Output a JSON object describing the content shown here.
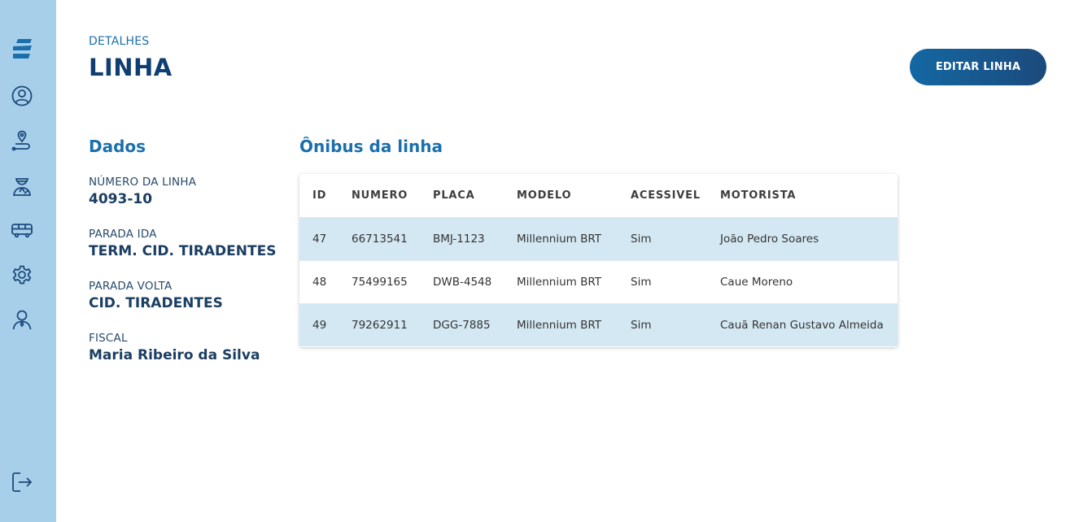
{
  "header": {
    "subtitle": "DETALHES",
    "title": "LINHA",
    "edit_button": "EDITAR LINHA"
  },
  "sidebar": {
    "icons": [
      "logo-icon",
      "user-circle-icon",
      "route-pin-icon",
      "inspector-icon",
      "bus-icon",
      "gear-icon",
      "person-icon",
      "logout-icon"
    ]
  },
  "dados": {
    "title": "Dados",
    "fields": [
      {
        "label": "NÚMERO DA LINHA",
        "value": "4093-10"
      },
      {
        "label": "PARADA IDA",
        "value": "TERM. CID. TIRADENTES"
      },
      {
        "label": "PARADA VOLTA",
        "value": "CID. TIRADENTES"
      },
      {
        "label": "FISCAL",
        "value": "Maria Ribeiro da Silva"
      }
    ]
  },
  "onibus": {
    "title": "Ônibus da linha",
    "columns": [
      "ID",
      "NUMERO",
      "PLACA",
      "MODELO",
      "ACESSIVEL",
      "MOTORISTA"
    ],
    "rows": [
      {
        "id": "47",
        "numero": "66713541",
        "placa": "BMJ-1123",
        "modelo": "Millennium BRT",
        "acessivel": "Sim",
        "motorista": "João Pedro Soares"
      },
      {
        "id": "48",
        "numero": "75499165",
        "placa": "DWB-4548",
        "modelo": "Millennium BRT",
        "acessivel": "Sim",
        "motorista": "Caue Moreno"
      },
      {
        "id": "49",
        "numero": "79262911",
        "placa": "DGG-7885",
        "modelo": "Millennium BRT",
        "acessivel": "Sim",
        "motorista": "Cauã Renan Gustavo Almeida"
      }
    ]
  },
  "colors": {
    "sidebar_bg": "#a8cfea",
    "accent": "#1a6fad",
    "title_dark": "#0f3e73",
    "row_highlight": "#d4e8f3"
  }
}
